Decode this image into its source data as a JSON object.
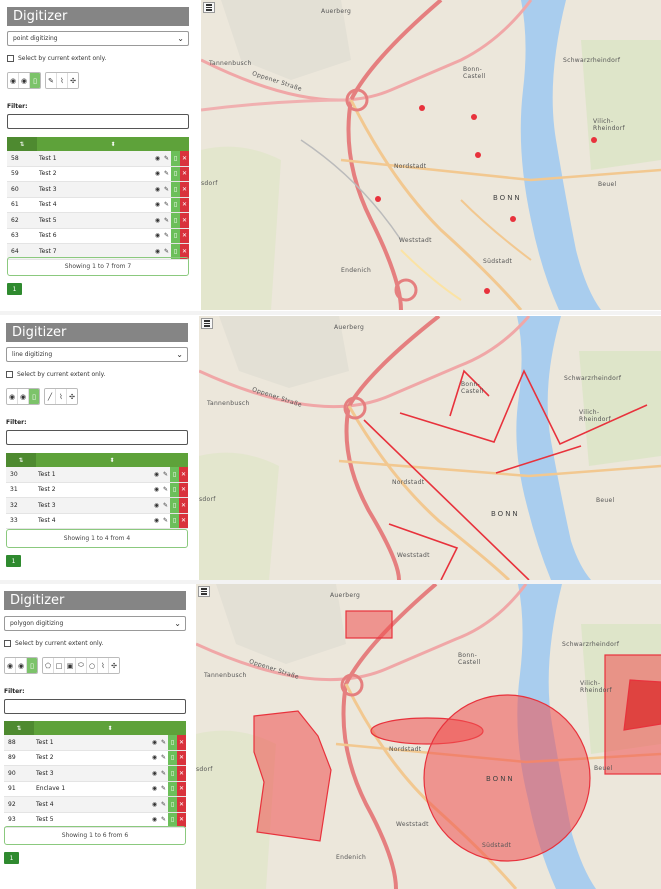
{
  "panels": [
    {
      "title": "Digitizer",
      "mode": "point digitizing",
      "extent_checkbox": "Select by current extent only.",
      "filter_label": "Filter:",
      "rows": [
        {
          "id": "58",
          "name": "Test 1"
        },
        {
          "id": "59",
          "name": "Test 2"
        },
        {
          "id": "60",
          "name": "Test 3"
        },
        {
          "id": "61",
          "name": "Test 4"
        },
        {
          "id": "62",
          "name": "Test 5"
        },
        {
          "id": "63",
          "name": "Test 6"
        },
        {
          "id": "64",
          "name": "Test 7"
        }
      ],
      "showing": "Showing 1 to 7 from 7",
      "page": "1"
    },
    {
      "title": "Digitizer",
      "mode": "line digitizing",
      "extent_checkbox": "Select by current extent only.",
      "filter_label": "Filter:",
      "rows": [
        {
          "id": "30",
          "name": "Test 1"
        },
        {
          "id": "31",
          "name": "Test 2"
        },
        {
          "id": "32",
          "name": "Test 3"
        },
        {
          "id": "33",
          "name": "Test 4"
        }
      ],
      "showing": "Showing 1 to 4 from 4",
      "page": "1"
    },
    {
      "title": "Digitizer",
      "mode": "polygon digitizing",
      "extent_checkbox": "Select by current extent only.",
      "filter_label": "Filter:",
      "rows": [
        {
          "id": "88",
          "name": "Test 1"
        },
        {
          "id": "89",
          "name": "Test 2"
        },
        {
          "id": "90",
          "name": "Test 3"
        },
        {
          "id": "91",
          "name": "Enclave 1"
        },
        {
          "id": "92",
          "name": "Test 4"
        },
        {
          "id": "93",
          "name": "Test 5"
        }
      ],
      "showing": "Showing 1 to 6 from 6",
      "page": "1"
    }
  ],
  "map_labels": {
    "auerberg": "Auerberg",
    "tannenbusch": "Tannenbusch",
    "oppener": "Oppener Straße",
    "bonn_castell": "Bonn-Castell",
    "schwarzrheindorf": "Schwarzrheindorf",
    "vilich": "Vilich-Rheindorf",
    "nordstadt": "Nordstadt",
    "bonn": "BONN",
    "beuel": "Beuel",
    "weststadt": "Weststadt",
    "suedstadt": "Südstadt",
    "endenich": "Endenich",
    "dorf": "sdorf"
  },
  "colors": {
    "header_gray": "#858585",
    "table_green": "#5ea23a",
    "active_green": "#7cc36a",
    "delete_red": "#d9323c",
    "feature_red": "#e8323c",
    "river": "#a9cdee"
  },
  "icons": [
    "menu-icon",
    "chevron-down-icon",
    "eye-icon",
    "edit-icon",
    "zoom-icon",
    "close-icon",
    "sort-icon"
  ]
}
